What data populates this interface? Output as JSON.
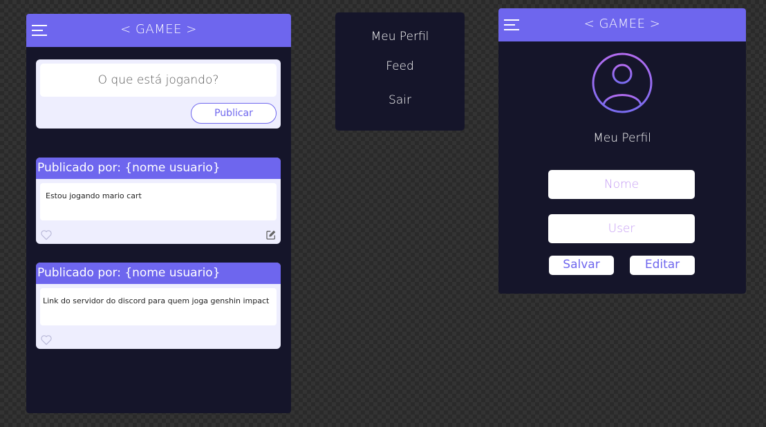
{
  "colors": {
    "accent": "#6e66ee",
    "panel": "#15152a",
    "card": "#eeeefe",
    "placeholder": "#c59cf4"
  },
  "feed_screen": {
    "app_title": "< GAMEE >",
    "composer": {
      "placeholder": "O que está jogando?",
      "publish_label": "Publicar"
    },
    "posts": [
      {
        "author_label": "Publicado por: {nome usuario}",
        "text": "Estou jogando mario cart",
        "icons": [
          "heart-icon",
          "edit-icon"
        ]
      },
      {
        "author_label": "Publicado por: {nome usuario}",
        "text": "Link do servidor do discord para quem joga genshin impact",
        "icons": [
          "heart-icon"
        ]
      }
    ]
  },
  "side_menu": {
    "items": [
      {
        "label": "Meu Perfil"
      },
      {
        "label": "Feed"
      },
      {
        "label": "Sair"
      }
    ]
  },
  "profile_screen": {
    "app_title": "< GAMEE >",
    "avatar_icon": "user-avatar-icon",
    "label": "Meu Perfil",
    "name_placeholder": "Nome",
    "user_placeholder": "User",
    "save_label": "Salvar",
    "edit_label": "Editar"
  }
}
